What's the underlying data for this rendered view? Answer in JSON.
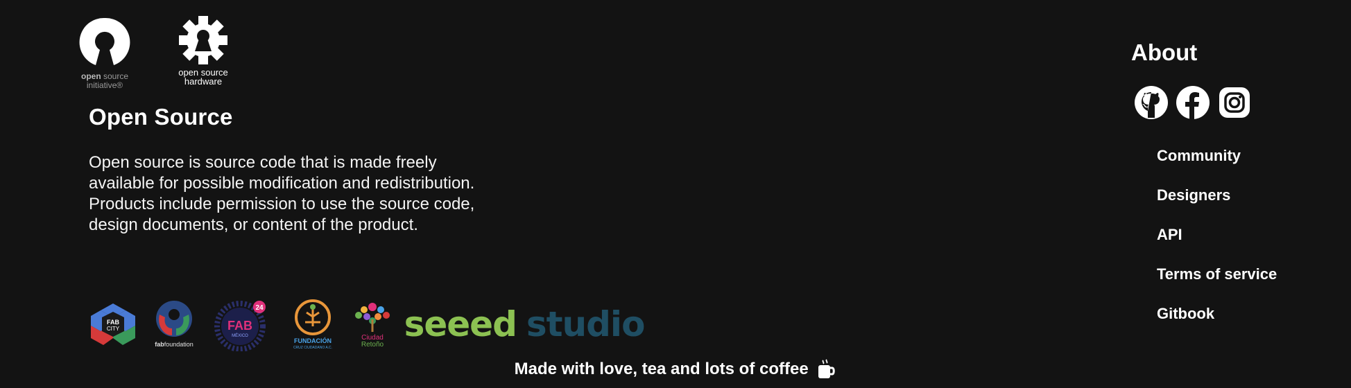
{
  "logos": {
    "osi": {
      "line1_bold": "open",
      "line1_rest": " source",
      "line2": "initiative®"
    },
    "osh": {
      "line1": "open source",
      "line2": "hardware"
    }
  },
  "open_source": {
    "title": "Open Source",
    "description": "Open source is source code that is made freely available for possible modification and redistribution. Products include permission to use the source code, design documents, or content of the product."
  },
  "partners": {
    "fab_city": {
      "line1": "FAB",
      "line2": "CITY"
    },
    "fab_foundation": {
      "bold": "fab",
      "rest": "foundation"
    },
    "fab_mexico": {
      "main": "FAB",
      "sub": "MÉXICO",
      "badge": "24"
    },
    "fundacion": {
      "name": "FUNDACIÓN",
      "sub": "CRUZ CIUDADANO A.C."
    },
    "ciudad_retono": {
      "line1": "Ciudad",
      "line2": "Retoño"
    },
    "seeed": {
      "word1": "seeed",
      "word2": "studio"
    }
  },
  "about": {
    "title": "About",
    "social": [
      {
        "name": "github-icon"
      },
      {
        "name": "facebook-icon"
      },
      {
        "name": "instagram-icon"
      }
    ],
    "links": [
      "Community",
      "Designers",
      "API",
      "Terms of service",
      "Gitbook"
    ]
  },
  "footer": {
    "text": "Made with love, tea and lots of coffee"
  },
  "colors": {
    "background": "#131313",
    "text": "#ffffff",
    "seeed_green": "#8cc152",
    "seeed_blue": "#1f4e63"
  }
}
